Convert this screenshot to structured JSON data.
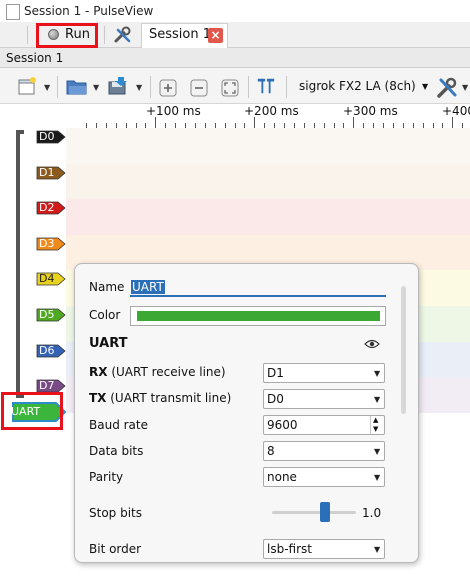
{
  "window": {
    "title": "Session 1 - PulseView"
  },
  "tabs": {
    "run_label": "Run",
    "session_tab_label": "Session 1",
    "close_glyph": "×"
  },
  "session_header": {
    "label": "Session 1"
  },
  "toolbar": {
    "device": "sigrok FX2 LA (8ch)"
  },
  "ruler": {
    "ticks": [
      "+100 ms",
      "+200 ms",
      "+300 ms",
      "+400"
    ]
  },
  "channels": [
    {
      "label": "D0",
      "color": "#1a1a1a",
      "band": "#faf7f3"
    },
    {
      "label": "D1",
      "color": "#8b5a1c",
      "band": "#faf3ec"
    },
    {
      "label": "D2",
      "color": "#d11a1a",
      "band": "#fbe9e9"
    },
    {
      "label": "D3",
      "color": "#f08a1a",
      "band": "#fdf0e2"
    },
    {
      "label": "D4",
      "color": "#e9d21e",
      "band": "#fcfae2"
    },
    {
      "label": "D5",
      "color": "#4faa22",
      "band": "#eef7e6"
    },
    {
      "label": "D6",
      "color": "#3463b3",
      "band": "#e9eef7"
    },
    {
      "label": "D7",
      "color": "#7a4a86",
      "band": "#f2ecf4"
    }
  ],
  "decoder": {
    "label": "UART",
    "color": "#3cb53c"
  },
  "popup": {
    "name_label": "Name",
    "name_value": "UART",
    "color_label": "Color",
    "color_value": "#3aa832",
    "section_title": "UART",
    "rx_label_bold": "RX",
    "rx_label_rest": " (UART receive line)",
    "rx_value": "D1",
    "tx_label_bold": "TX",
    "tx_label_rest": " (UART transmit line)",
    "tx_value": "D0",
    "baud_label": "Baud rate",
    "baud_value": "9600",
    "databits_label": "Data bits",
    "databits_value": "8",
    "parity_label": "Parity",
    "parity_value": "none",
    "stopbits_label": "Stop bits",
    "stopbits_value": "1.0",
    "bitorder_label": "Bit order",
    "bitorder_value": "lsb-first"
  }
}
